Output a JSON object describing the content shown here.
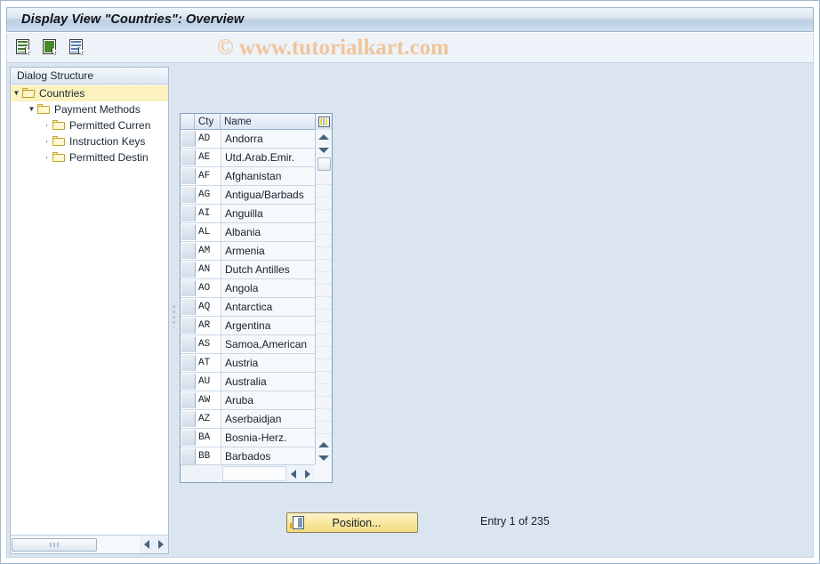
{
  "window": {
    "title": "Display View \"Countries\": Overview"
  },
  "watermark": "© www.tutorialkart.com",
  "toolbar": {
    "buttons": [
      {
        "name": "display-details-button",
        "icon": "document-green-lines-icon"
      },
      {
        "name": "display-selected-button",
        "icon": "document-green-filled-icon"
      },
      {
        "name": "display-list-button",
        "icon": "document-blue-lines-icon"
      }
    ]
  },
  "tree": {
    "header": "Dialog Structure",
    "items": [
      {
        "label": "Countries",
        "icon": "open-folder-icon",
        "twisty": "▼",
        "depth": 0,
        "selected": true
      },
      {
        "label": "Payment Methods",
        "icon": "folder-icon",
        "twisty": "▼",
        "depth": 1,
        "selected": false
      },
      {
        "label": "Permitted Curren",
        "icon": "folder-icon",
        "twisty": "•",
        "depth": 2,
        "selected": false
      },
      {
        "label": "Instruction Keys",
        "icon": "folder-icon",
        "twisty": "•",
        "depth": 2,
        "selected": false
      },
      {
        "label": "Permitted Destin",
        "icon": "folder-icon",
        "twisty": "•",
        "depth": 2,
        "selected": false
      }
    ]
  },
  "table": {
    "columns": [
      {
        "key": "cty",
        "label": "Cty"
      },
      {
        "key": "name",
        "label": "Name"
      }
    ],
    "config_icon": "column-settings-icon",
    "rows": [
      {
        "cty": "AD",
        "name": "Andorra"
      },
      {
        "cty": "AE",
        "name": "Utd.Arab.Emir."
      },
      {
        "cty": "AF",
        "name": "Afghanistan"
      },
      {
        "cty": "AG",
        "name": "Antigua/Barbads"
      },
      {
        "cty": "AI",
        "name": "Anguilla"
      },
      {
        "cty": "AL",
        "name": "Albania"
      },
      {
        "cty": "AM",
        "name": "Armenia"
      },
      {
        "cty": "AN",
        "name": "Dutch Antilles"
      },
      {
        "cty": "AO",
        "name": "Angola"
      },
      {
        "cty": "AQ",
        "name": "Antarctica"
      },
      {
        "cty": "AR",
        "name": "Argentina"
      },
      {
        "cty": "AS",
        "name": "Samoa,American"
      },
      {
        "cty": "AT",
        "name": "Austria"
      },
      {
        "cty": "AU",
        "name": "Australia"
      },
      {
        "cty": "AW",
        "name": "Aruba"
      },
      {
        "cty": "AZ",
        "name": "Aserbaidjan"
      },
      {
        "cty": "BA",
        "name": "Bosnia-Herz."
      },
      {
        "cty": "BB",
        "name": "Barbados"
      }
    ]
  },
  "footer": {
    "position_button": "Position...",
    "entry_status": "Entry 1 of 235"
  },
  "colors": {
    "title_bar_accent": "#bccfe3",
    "selection_yellow": "#fbf2bf",
    "button_yellow": "#f7e79d",
    "watermark": "#f0c49a",
    "body_background": "#dbe5f0"
  }
}
